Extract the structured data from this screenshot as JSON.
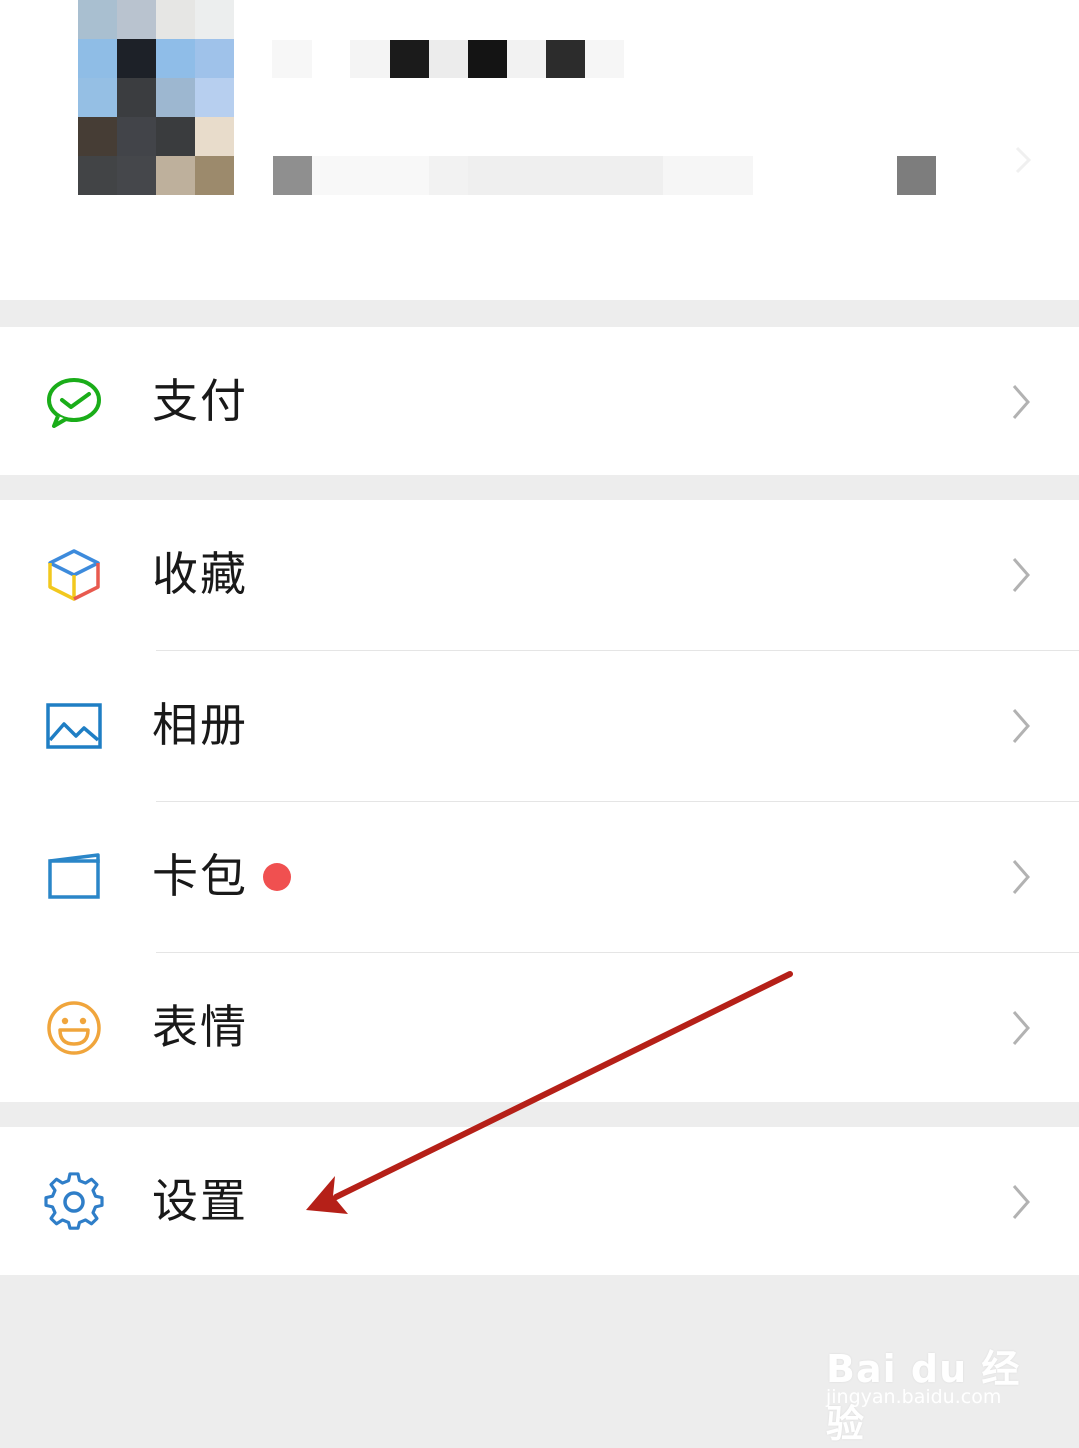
{
  "profile": {
    "blurred": true
  },
  "menu": {
    "pay": {
      "label": "支付",
      "icon": "wechat-pay-icon",
      "color": "#1aad19"
    },
    "favorites": {
      "label": "收藏",
      "icon": "cube-icon"
    },
    "album": {
      "label": "相册",
      "icon": "picture-icon",
      "color": "#1f7ec4"
    },
    "cards": {
      "label": "卡包",
      "icon": "wallet-icon",
      "color": "#2a86c8",
      "has_badge": true,
      "badge_color": "#f05050"
    },
    "stickers": {
      "label": "表情",
      "icon": "smiley-icon",
      "color": "#f0a53c"
    },
    "settings": {
      "label": "设置",
      "icon": "gear-icon",
      "color": "#2f7ec8"
    }
  },
  "annotation": {
    "arrow_color": "#b52018",
    "points_to": "settings"
  },
  "watermark": {
    "brand": "Bai du 经验",
    "url": "jingyan.baidu.com"
  }
}
